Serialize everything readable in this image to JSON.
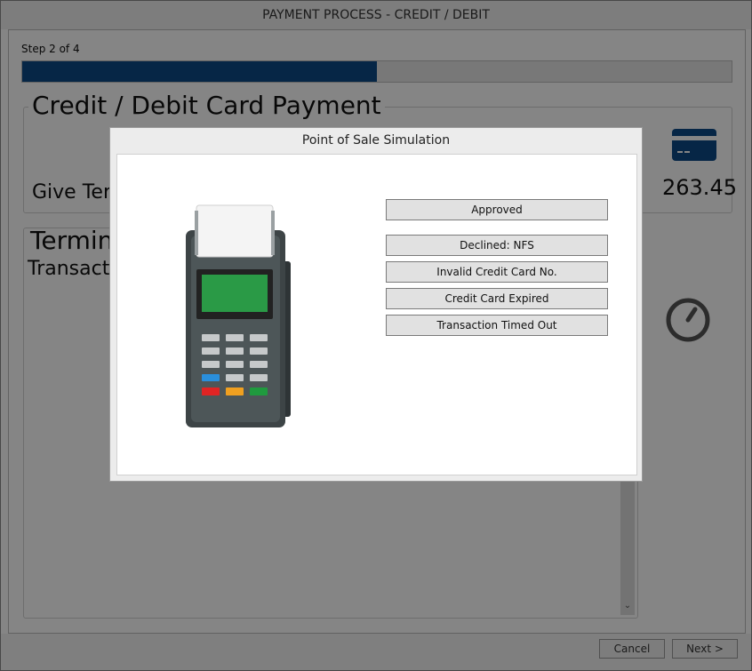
{
  "window": {
    "title": "PAYMENT PROCESS - CREDIT / DEBIT"
  },
  "progress": {
    "step_label": "Step 2 of 4",
    "fraction": 0.5
  },
  "payment": {
    "title": "Credit / Debit Card Payment",
    "give_text": "Give Ter",
    "amount": "263.45",
    "card_icon": "credit-card-icon"
  },
  "terminal": {
    "title": "Termina",
    "transact_text": "Transact",
    "status_icon": "gauge-icon"
  },
  "footer": {
    "cancel_label": "Cancel",
    "next_label": "Next >"
  },
  "dialog": {
    "title": "Point of Sale Simulation",
    "options": [
      {
        "label": "Approved"
      },
      {
        "label": "Declined: NFS"
      },
      {
        "label": "Invalid Credit Card No."
      },
      {
        "label": "Credit Card Expired"
      },
      {
        "label": "Transaction Timed Out"
      }
    ]
  },
  "colors": {
    "accent": "#0d4a86",
    "overlay": "rgba(0,0,0,0.48)"
  }
}
